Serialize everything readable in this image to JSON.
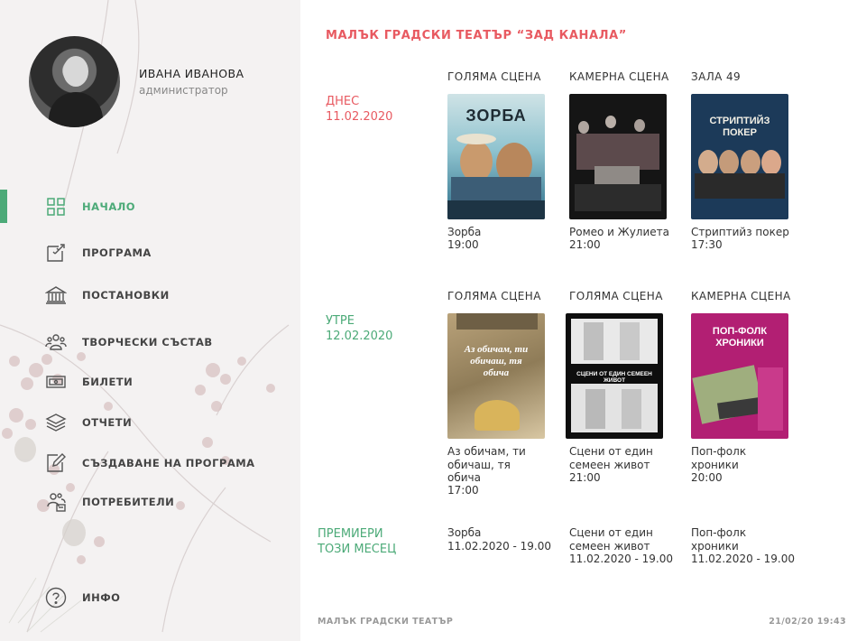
{
  "user": {
    "name": "ИВАНА ИВАНОВА",
    "role": "администратор"
  },
  "nav": [
    {
      "label": "НАЧАЛО",
      "icon": "grid-icon",
      "active": true
    },
    {
      "label": "ПРОГРАМА",
      "icon": "program-icon"
    },
    {
      "label": "ПОСТАНОВКИ",
      "icon": "theater-building-icon"
    },
    {
      "label": "ТВОРЧЕСКИ СЪСТАВ",
      "icon": "people-icon"
    },
    {
      "label": "БИЛЕТИ",
      "icon": "ticket-icon"
    },
    {
      "label": "ОТЧЕТИ",
      "icon": "layers-icon"
    },
    {
      "label": "СЪЗДАВАНЕ НА ПРОГРАМА",
      "icon": "edit-icon"
    },
    {
      "label": "ПОТРЕБИТЕЛИ",
      "icon": "users-manage-icon"
    },
    {
      "label": "ИНФО",
      "icon": "help-icon"
    }
  ],
  "main": {
    "title": "МАЛЪК ГРАДСКИ ТЕАТЪР “ЗАД КАНАЛА”",
    "today": {
      "label": "ДНЕС",
      "date": "11.02.2020",
      "shows": [
        {
          "stage": "ГОЛЯМА СЦЕНА",
          "title": "Зорба",
          "time": "19:00",
          "poster_text": "ЗОРБА"
        },
        {
          "stage": "КАМЕРНА СЦЕНА",
          "title": "Ромео и Жулиета",
          "time": "21:00",
          "poster_text": ""
        },
        {
          "stage": "ЗАЛА 49",
          "title": "Стриптийз покер",
          "time": "17:30",
          "poster_text": "СТРИПТИЙЗ ПОКЕР"
        }
      ]
    },
    "tomorrow": {
      "label": "УТРЕ",
      "date": "12.02.2020",
      "shows": [
        {
          "stage": "ГОЛЯМА СЦЕНА",
          "title_line1": "Аз обичам, ти",
          "title_line2": "обичаш, тя",
          "title_line3": "обича",
          "time": "17:00",
          "poster_text": "Аз обичам, ти обичаш, тя обича"
        },
        {
          "stage": "ГОЛЯМА СЦЕНА",
          "title_line1": "Сцени от един",
          "title_line2": "семеен живот",
          "time": "21:00",
          "poster_text": "СЦЕНИ ОТ ЕДИН СЕМЕЕН ЖИВОТ"
        },
        {
          "stage": "КАМЕРНА СЦЕНА",
          "title_line1": "Поп-фолк",
          "title_line2": "хроники",
          "time": "20:00",
          "poster_text": "ПОП-ФОЛК ХРОНИКИ"
        }
      ]
    },
    "premieres": {
      "label_line1": "ПРЕМИЕРИ",
      "label_line2": "ТОЗИ МЕСЕЦ",
      "items": [
        {
          "line1": "Зорба",
          "line2": "11.02.2020 - 19.00"
        },
        {
          "line1": "Сцени от един",
          "line2": "семеен живот",
          "line3": "11.02.2020 - 19.00"
        },
        {
          "line1": "Поп-фолк",
          "line2": "хроники",
          "line3": "11.02.2020 - 19.00"
        }
      ]
    }
  },
  "footer": {
    "left": "МАЛЪК ГРАДСКИ ТЕАТЪР",
    "right": "21/02/20 19:43"
  },
  "colors": {
    "accent_green": "#4caa78",
    "accent_red": "#e85a61"
  }
}
